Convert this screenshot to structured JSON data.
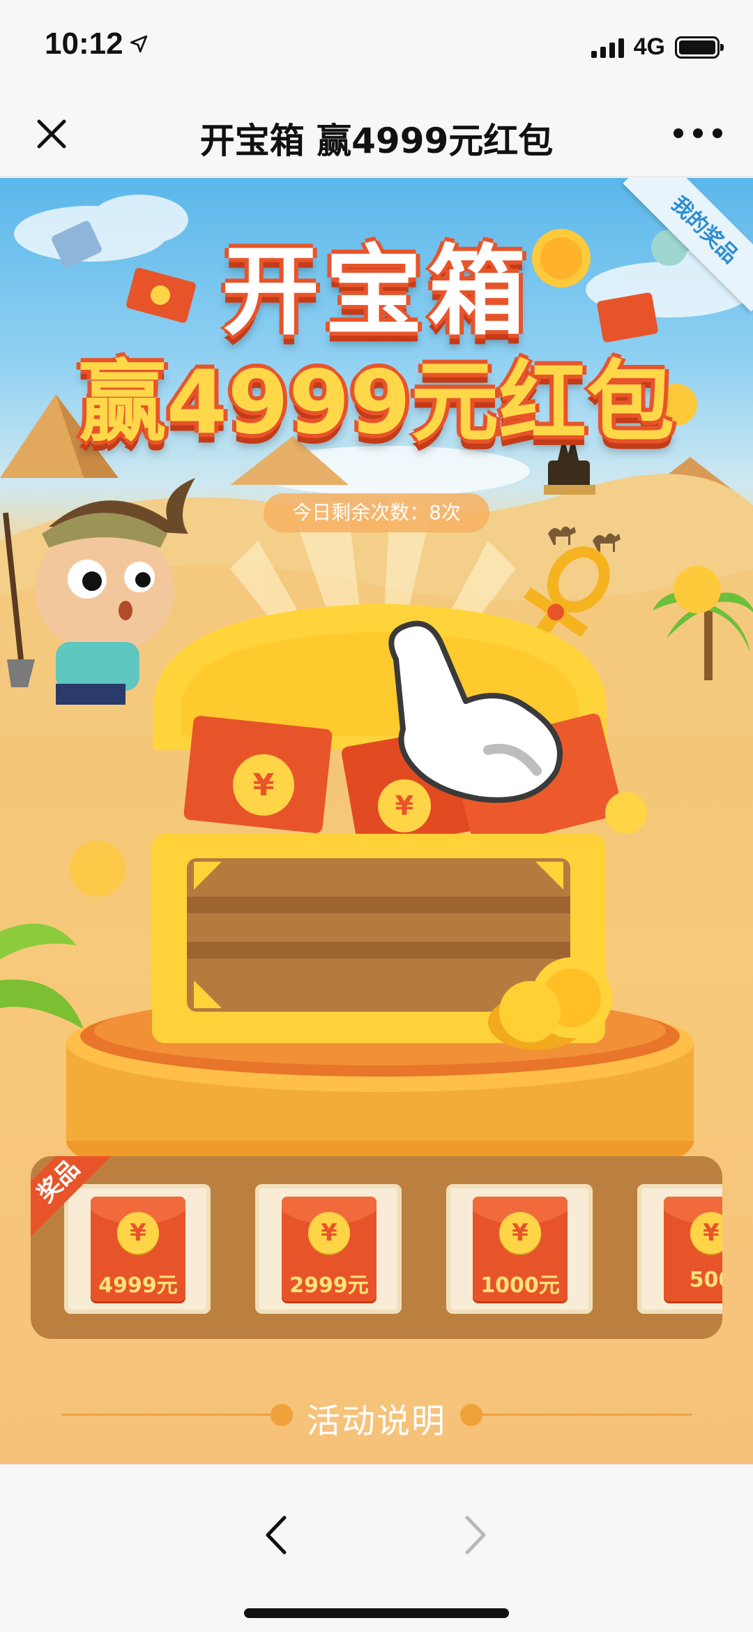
{
  "status_bar": {
    "time": "10:12",
    "network": "4G",
    "battery_level": 1.0
  },
  "nav": {
    "title": "开宝箱 赢4999元红包"
  },
  "banner": {
    "headline_line1": "开宝箱",
    "headline_line2": "赢4999元红包",
    "my_prize_label": "我的奖品",
    "remaining_label": "今日剩余次数：8次"
  },
  "prizes": {
    "badge": "奖品",
    "items": [
      {
        "amount": "4999元",
        "icon": "¥"
      },
      {
        "amount": "2999元",
        "icon": "¥"
      },
      {
        "amount": "1000元",
        "icon": "¥"
      },
      {
        "amount": "500",
        "icon": "¥"
      }
    ]
  },
  "activity": {
    "title": "活动说明"
  },
  "colors": {
    "accent": "#e8542a",
    "gold": "#ffd447",
    "panel": "#bb8040",
    "sky": "#5bb7ea",
    "sand": "#f2c676"
  }
}
